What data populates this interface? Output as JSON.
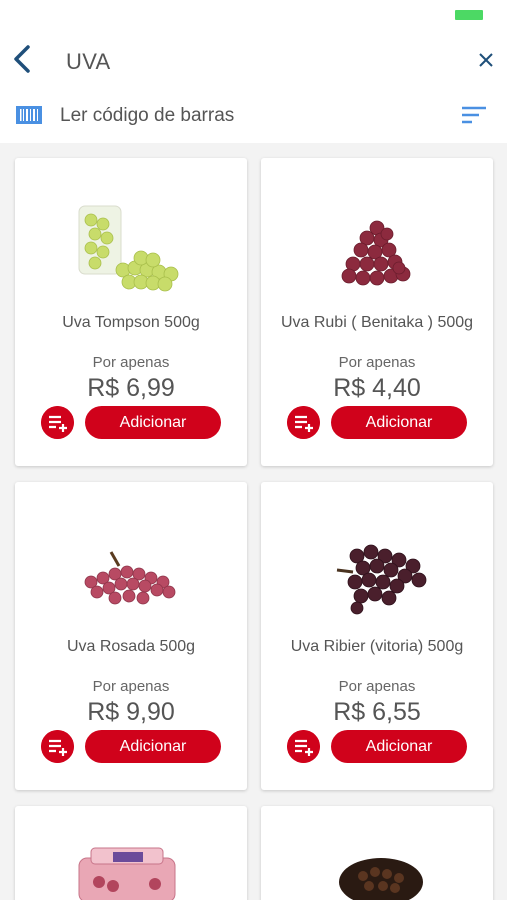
{
  "header": {
    "search_query": "UVA",
    "barcode_label": "Ler código de barras"
  },
  "products": [
    {
      "name": "Uva Tompson 500g",
      "promo": "Por apenas",
      "price": "R$ 6,99",
      "add_label": "Adicionar"
    },
    {
      "name": "Uva Rubi ( Benitaka ) 500g",
      "promo": "Por apenas",
      "price": "R$ 4,40",
      "add_label": "Adicionar"
    },
    {
      "name": "Uva Rosada 500g",
      "promo": "Por apenas",
      "price": "R$ 9,90",
      "add_label": "Adicionar"
    },
    {
      "name": "Uva Ribier (vitoria) 500g",
      "promo": "Por apenas",
      "price": "R$ 6,55",
      "add_label": "Adicionar"
    }
  ],
  "colors": {
    "accent": "#d0021b",
    "nav_blue": "#1f4f7a",
    "barcode_blue": "#4a90e2",
    "battery_green": "#4cd964"
  },
  "icons": [
    "back-arrow-icon",
    "close-icon",
    "barcode-icon",
    "filter-sort-icon",
    "add-to-list-icon"
  ]
}
